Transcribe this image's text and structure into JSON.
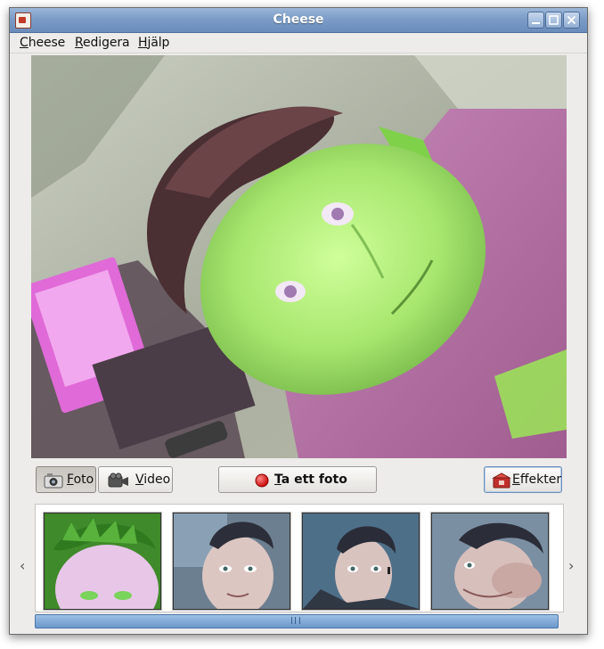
{
  "window": {
    "title": "Cheese"
  },
  "menubar": {
    "items": [
      "Cheese",
      "Redigera",
      "Hjälp"
    ]
  },
  "controls": {
    "photo_label": "Foto",
    "video_label": "Video",
    "take_photo_label": "Ta ett foto",
    "effects_label": "Effekter",
    "active_mode": "Foto"
  },
  "gallery": {
    "thumbnail_count": 4,
    "thumbnails": [
      {
        "tint": "green"
      },
      {
        "tint": "normal"
      },
      {
        "tint": "normal"
      },
      {
        "tint": "warped"
      }
    ]
  },
  "icons": {
    "app": "cheese-app-icon",
    "minimize": "minimize-icon",
    "maximize": "maximize-icon",
    "close": "close-icon",
    "photo": "camera-icon",
    "video": "video-camera-icon",
    "record": "record-dot-icon",
    "effects": "effects-icon",
    "scroll_left": "chevron-left-icon",
    "scroll_right": "chevron-right-icon"
  },
  "colors": {
    "titlebar": "#7b9cc7",
    "record_dot": "#e02020",
    "scrollbar": "#7aa3d2"
  }
}
